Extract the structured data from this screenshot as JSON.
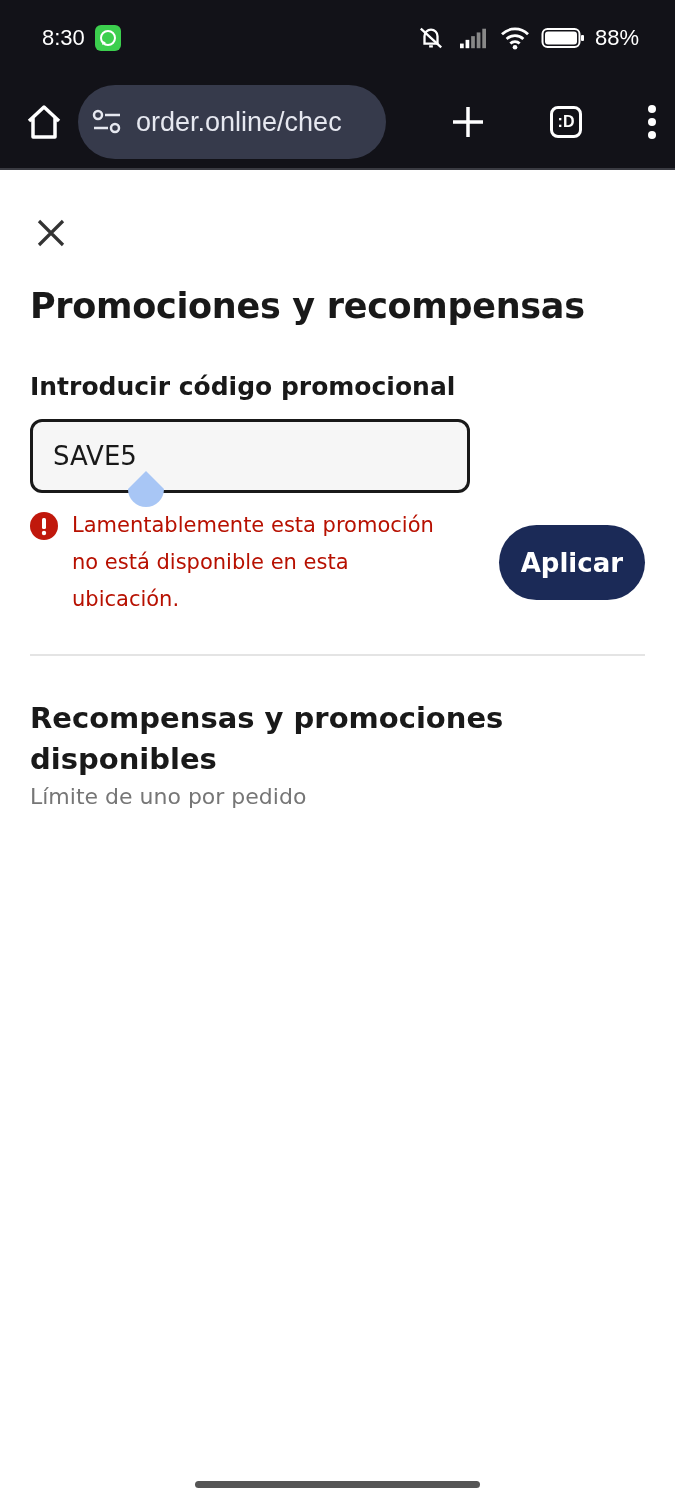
{
  "status_bar": {
    "time": "8:30",
    "battery": "88%"
  },
  "browser": {
    "url": "order.online/chec",
    "tab_switcher": ":D"
  },
  "sheet": {
    "title": "Promociones y recompensas",
    "promo_code": {
      "label": "Introducir código promocional",
      "value": "SAVE5",
      "error": "Lamentablemente esta promoción no está disponible en esta ubicación."
    },
    "apply_button": "Aplicar",
    "available": {
      "title": "Recompensas y promociones disponibles",
      "subtitle": "Límite de uno por pedido"
    }
  }
}
